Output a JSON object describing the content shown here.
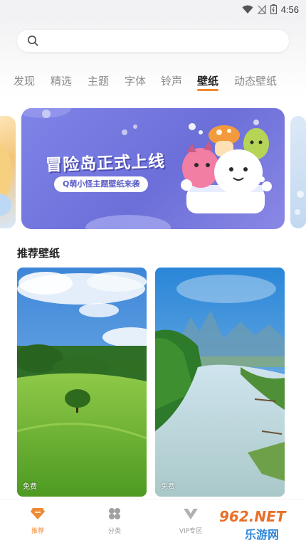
{
  "status_bar": {
    "time": "4:56",
    "icons": [
      "wifi-icon",
      "no-signal-icon",
      "battery-icon"
    ]
  },
  "search": {
    "placeholder": "",
    "value": ""
  },
  "tabs": [
    {
      "label": "发现",
      "active": false
    },
    {
      "label": "精选",
      "active": false
    },
    {
      "label": "主题",
      "active": false
    },
    {
      "label": "字体",
      "active": false
    },
    {
      "label": "铃声",
      "active": false
    },
    {
      "label": "壁纸",
      "active": true
    },
    {
      "label": "动态壁纸",
      "active": false
    }
  ],
  "banner": {
    "title": "冒险岛正式上线",
    "subtitle": "Q萌小怪主题壁纸来袭"
  },
  "section": {
    "title": "推荐壁纸"
  },
  "wallpapers": [
    {
      "badge": "免费"
    },
    {
      "badge": "免费"
    }
  ],
  "bottom_nav": [
    {
      "label": "推荐",
      "icon": "diamond-icon",
      "active": true
    },
    {
      "label": "分类",
      "icon": "grid-icon",
      "active": false
    },
    {
      "label": "VIP专区",
      "icon": "vip-icon",
      "active": false
    }
  ],
  "watermark": {
    "brand": "962.NET",
    "text": "乐游网"
  },
  "colors": {
    "accent": "#f08a33",
    "banner_bg": "#6c6fd8"
  }
}
